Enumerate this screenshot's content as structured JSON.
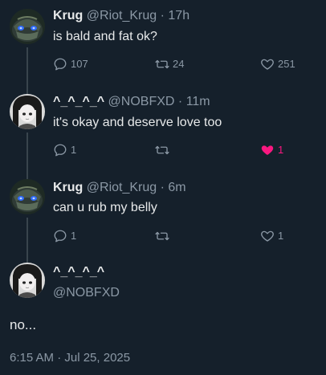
{
  "tweets": [
    {
      "name": "Krug",
      "handle": "@Riot_Krug",
      "time": "17h",
      "text": "is bald and fat ok?",
      "actions": {
        "replies": "107",
        "retweets": "24",
        "likes": "251"
      },
      "avatar_icon": "krug-avatar"
    },
    {
      "name": "^_^_^_^",
      "handle": "@NOBFXD",
      "time": "11m",
      "text": "it's okay and deserve love too",
      "actions": {
        "replies": "1",
        "retweets": "",
        "likes": "1"
      },
      "liked": true,
      "avatar_icon": "anime-girl-avatar"
    },
    {
      "name": "Krug",
      "handle": "@Riot_Krug",
      "time": "6m",
      "text": "can u rub my belly",
      "actions": {
        "replies": "1",
        "retweets": "",
        "likes": "1"
      },
      "avatar_icon": "krug-avatar"
    }
  ],
  "main_tweet": {
    "name": "^_^_^_^",
    "handle": "@NOBFXD",
    "text": "no...",
    "timestamp": "6:15 AM · Jul 25, 2025",
    "avatar_icon": "anime-girl-avatar"
  },
  "separator": "·",
  "colors": {
    "background": "#15202b",
    "text_primary": "#e7e9ea",
    "text_secondary": "#8b98a5",
    "like_active": "#f91880",
    "thread_line": "#38444d"
  }
}
